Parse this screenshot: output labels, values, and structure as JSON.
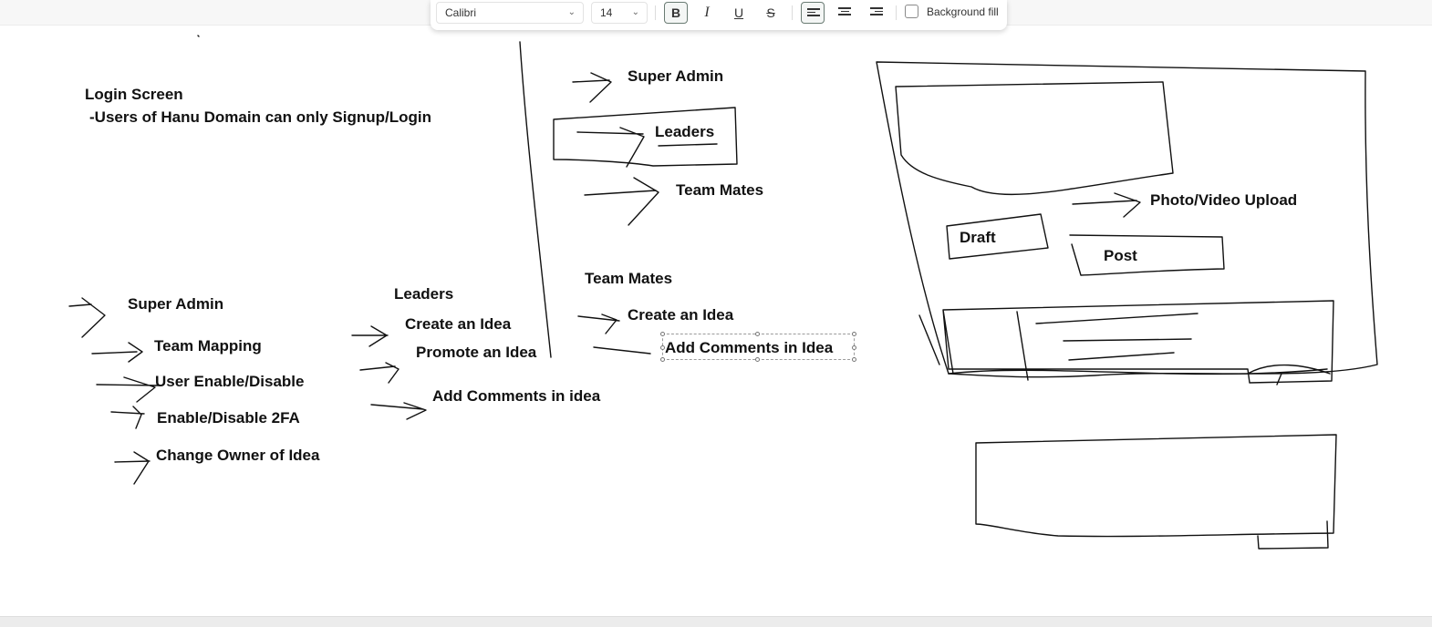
{
  "toolbar": {
    "font_family": "Calibri",
    "font_size": "14",
    "bold_label": "B",
    "italic_label": "I",
    "underline_label": "U",
    "strike_label": "S",
    "background_fill_label": "Background fill",
    "background_fill_checked": false,
    "bold_active": true,
    "align_active": "left"
  },
  "canvas": {
    "login": {
      "title": "Login Screen",
      "note": "-Users of Hanu Domain can only Signup/Login"
    },
    "super_admin_list": {
      "heading": "Super Admin",
      "items": [
        "Team Mapping",
        "User Enable/Disable",
        "Enable/Disable 2FA",
        "Change Owner of Idea"
      ]
    },
    "leaders_list": {
      "heading": "Leaders",
      "items": [
        "Create an Idea",
        "Promote an Idea",
        "Add Comments in idea"
      ]
    },
    "roles": {
      "super_admin": "Super Admin",
      "leaders": "Leaders",
      "team_mates": "Team Mates"
    },
    "team_mates_list": {
      "heading": "Team Mates",
      "items": [
        "Create an Idea",
        "Add Comments in Idea"
      ]
    },
    "mockup": {
      "photo_video": "Photo/Video Upload",
      "draft": "Draft",
      "post": "Post"
    }
  },
  "colors": {
    "ink": "#111111",
    "canvas": "#ffffff",
    "active_border": "#6a7b73"
  }
}
